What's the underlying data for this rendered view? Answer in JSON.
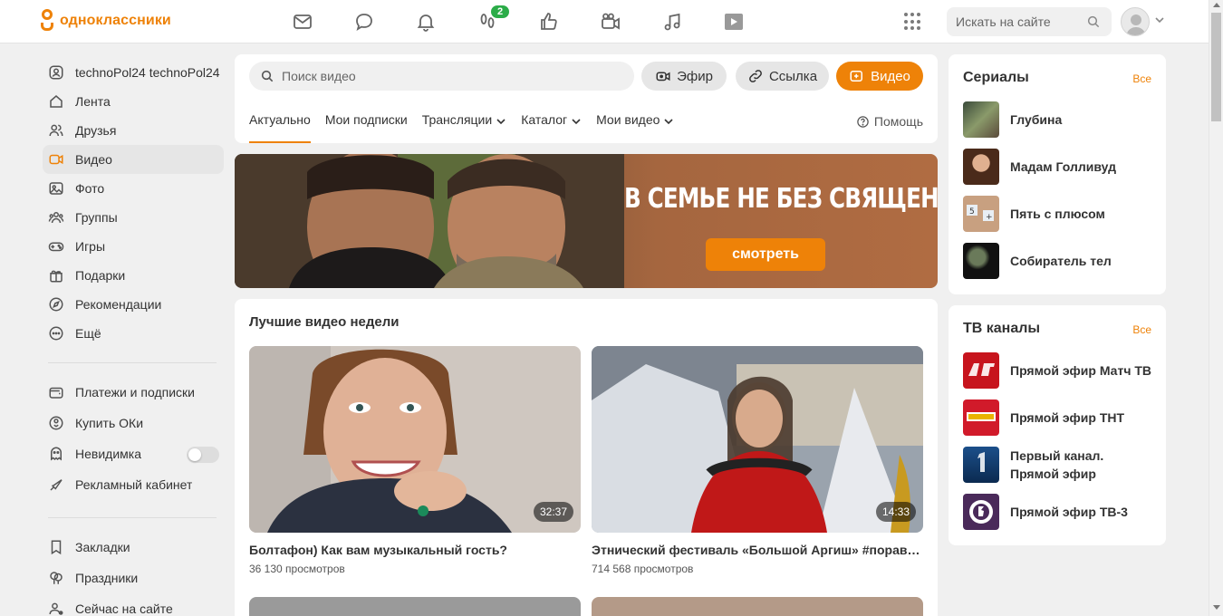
{
  "topbar": {
    "logo_text": "одноклассники",
    "notification_count": "2",
    "search_placeholder": "Искать на сайте",
    "icons": [
      "mail-icon",
      "chat-icon",
      "bell-icon",
      "guests-icon",
      "likes-icon",
      "video-camera-icon",
      "music-icon",
      "video-play-icon"
    ]
  },
  "sidebar": {
    "profile": "technoPol24 technoPol24",
    "items": [
      {
        "label": "Лента",
        "icon": "home-icon"
      },
      {
        "label": "Друзья",
        "icon": "friends-icon"
      },
      {
        "label": "Видео",
        "icon": "video-icon",
        "active": true
      },
      {
        "label": "Фото",
        "icon": "photo-icon"
      },
      {
        "label": "Группы",
        "icon": "groups-icon"
      },
      {
        "label": "Игры",
        "icon": "games-icon"
      },
      {
        "label": "Подарки",
        "icon": "gift-icon"
      },
      {
        "label": "Рекомендации",
        "icon": "compass-icon"
      },
      {
        "label": "Ещё",
        "icon": "more-icon"
      }
    ],
    "items2": [
      {
        "label": "Платежи и подписки",
        "icon": "wallet-icon"
      },
      {
        "label": "Купить ОКи",
        "icon": "coin-icon"
      },
      {
        "label": "Невидимка",
        "icon": "invisible-icon"
      },
      {
        "label": "Рекламный кабинет",
        "icon": "megaphone-icon"
      }
    ],
    "items3": [
      {
        "label": "Закладки",
        "icon": "bookmark-icon"
      },
      {
        "label": "Праздники",
        "icon": "balloons-icon"
      },
      {
        "label": "Сейчас на сайте",
        "icon": "online-icon"
      }
    ]
  },
  "video": {
    "search_placeholder": "Поиск видео",
    "btn_live": "Эфир",
    "btn_link": "Ссылка",
    "btn_video": "Видео",
    "tabs": [
      "Актуально",
      "Мои подписки",
      "Трансляции",
      "Каталог",
      "Мои видео"
    ],
    "help": "Помощь"
  },
  "banner": {
    "title": "В СЕМЬЕ НЕ БЕЗ СВЯЩЕННИКА",
    "button": "смотреть"
  },
  "best": {
    "title": "Лучшие видео недели",
    "videos": [
      {
        "title": "Болтафон) Как вам музыкальный гость?",
        "views": "36 130 просмотров",
        "duration": "32:37"
      },
      {
        "title": "Этнический фестиваль «Большой Аргиш» #поравнодуш",
        "views": "714 568 просмотров",
        "duration": "14:33"
      }
    ]
  },
  "serials": {
    "title": "Сериалы",
    "all": "Все",
    "items": [
      "Глубина",
      "Мадам Голливуд",
      "Пять с плюсом",
      "Собиратель тел"
    ]
  },
  "tv": {
    "title": "ТВ каналы",
    "all": "Все",
    "items": [
      "Прямой эфир Матч ТВ",
      "Прямой эфир ТНТ",
      "Первый канал. Прямой эфир",
      "Прямой эфир ТВ-3"
    ]
  },
  "colors": {
    "accent": "#ee8208",
    "badge": "#2bac48"
  }
}
